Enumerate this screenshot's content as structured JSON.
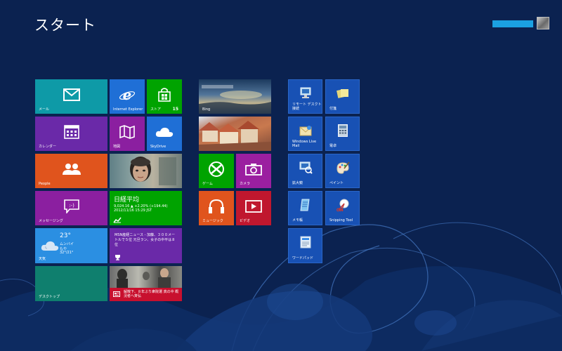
{
  "screen_title": "スタート",
  "tiles": {
    "mail": {
      "label": "メール",
      "color": "#0e9aa7",
      "icon": "envelope-icon"
    },
    "ie": {
      "label": "Internet Explorer",
      "color": "#1f6fd6",
      "icon": "internet-explorer-icon"
    },
    "store": {
      "label": "ストア",
      "count": "15",
      "color": "#00a300",
      "icon": "shopping-bag-icon"
    },
    "calendar": {
      "label": "カレンダー",
      "color": "#6a29a8",
      "icon": "calendar-icon"
    },
    "maps": {
      "label": "地図",
      "color": "#8b1fa0",
      "icon": "map-icon"
    },
    "skydrive": {
      "label": "SkyDrive",
      "color": "#1f6fd6",
      "icon": "cloud-icon"
    },
    "people": {
      "label": "People",
      "color": "#e0541d",
      "icon": "people-icon"
    },
    "messaging": {
      "label": "メッセージング",
      "color": "#8b1fa0",
      "icon": "chat-bubble-icon"
    },
    "finance": {
      "label": "",
      "title": "日経平均",
      "line1": "9,024.16 ▲ +2.20% (+194.44)",
      "line2": "2012/11/16 15:29 JST",
      "color": "#00a300",
      "icon": "chart-up-icon"
    },
    "weather": {
      "label": "天気",
      "temp": "23°",
      "city": "ムンバイ",
      "condition": "もや",
      "range": "32°/21°",
      "color": "#2b8fe2",
      "icon": "cloud-sun-icon"
    },
    "news": {
      "label": "",
      "text": "MSN産経ニュース - 加藤、３００メートルで５位 元旦ラン、女子の中平は８位",
      "color": "#6a29a8",
      "icon": "trophy-icon"
    },
    "desktop": {
      "label": "デスクトップ",
      "color": "#0f7f6e"
    },
    "photo_news": {
      "caption": "解散下、８年ぶり衆院選 真の中 概況者へ斉弘",
      "icon": "news-icon"
    },
    "bing": {
      "label": "Bing"
    },
    "travel": {
      "label": ""
    },
    "games": {
      "label": "ゲーム",
      "color": "#00a300",
      "icon": "game-controller-icon"
    },
    "camera": {
      "label": "カメラ",
      "color": "#9b1fa0",
      "icon": "camera-icon"
    },
    "music": {
      "label": "ミュージック",
      "color": "#e0541d",
      "icon": "headphones-icon"
    },
    "video": {
      "label": "ビデオ",
      "color": "#c0172e",
      "icon": "play-icon"
    },
    "remote_desktop": {
      "label": "リモート デスクトップ\n接続",
      "icon": "remote-desktop-icon"
    },
    "sticky_notes": {
      "label": "付箋",
      "icon": "sticky-notes-icon"
    },
    "live_mail": {
      "label": "Windows Live\nMail",
      "icon": "live-mail-icon"
    },
    "calculator": {
      "label": "電卓",
      "icon": "calculator-icon"
    },
    "magnifier": {
      "label": "拡大鏡",
      "icon": "magnifier-icon"
    },
    "paint": {
      "label": "ペイント",
      "icon": "paint-palette-icon"
    },
    "notepad": {
      "label": "メモ帳",
      "icon": "notepad-icon"
    },
    "snipping_tool": {
      "label": "Snipping Tool",
      "icon": "scissors-icon"
    },
    "wordpad": {
      "label": "ワードパッド",
      "icon": "wordpad-icon"
    }
  }
}
